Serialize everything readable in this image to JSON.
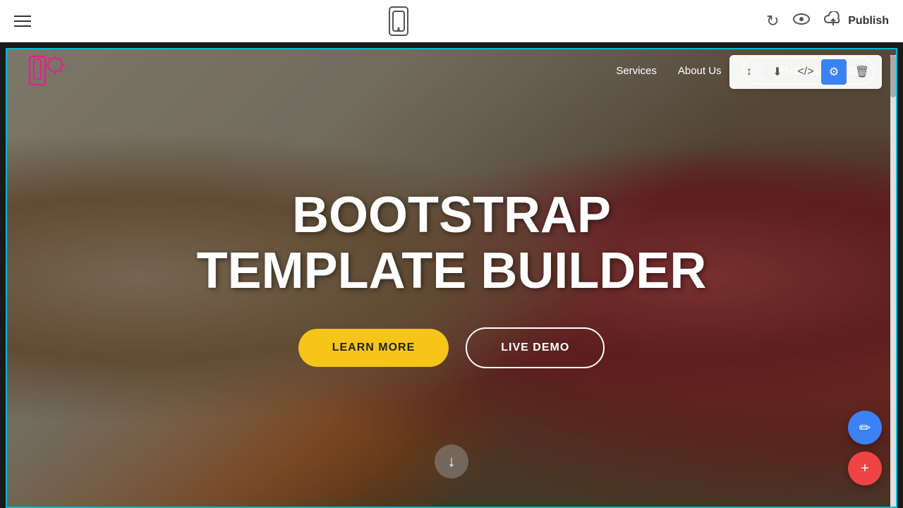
{
  "toolbar": {
    "undo_label": "↺",
    "eye_label": "👁",
    "publish_label": "Publish",
    "cloud_icon": "☁"
  },
  "nav": {
    "services_label": "Services",
    "about_label": "About Us",
    "phone": "+1-234-567-8901"
  },
  "hero": {
    "title_line1": "BOOTSTRAP",
    "title_line2": "TEMPLATE BUILDER",
    "btn_learn": "LEARN MORE",
    "btn_demo": "LIVE DEMO"
  },
  "section_toolbar": {
    "move_icon": "↕",
    "download_icon": "⬇",
    "code_icon": "</>",
    "settings_icon": "⚙",
    "delete_icon": "🗑"
  },
  "fab": {
    "pencil_icon": "✏",
    "plus_icon": "+"
  }
}
